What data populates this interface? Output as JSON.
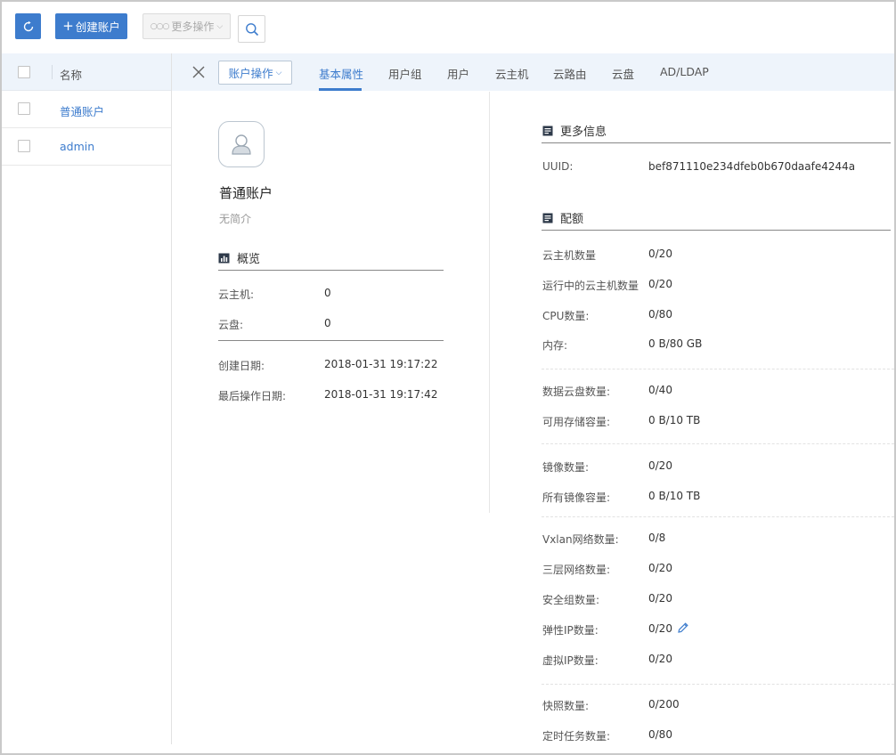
{
  "toolbar": {
    "refresh_icon": "refresh-icon",
    "create_label": "创建账户",
    "more_label": "更多操作",
    "search_icon": "search-icon"
  },
  "list": {
    "header": "名称",
    "rows": [
      "普通账户",
      "admin"
    ]
  },
  "detail": {
    "account_ops_label": "账户操作",
    "tabs": [
      "基本属性",
      "用户组",
      "用户",
      "云主机",
      "云路由",
      "云盘",
      "AD/LDAP"
    ],
    "active_tab": "基本属性"
  },
  "account": {
    "name": "普通账户",
    "description": "无简介"
  },
  "overview": {
    "title": "概览",
    "items": [
      {
        "label": "云主机:",
        "value": "0"
      },
      {
        "label": "云盘:",
        "value": "0"
      }
    ],
    "dates": [
      {
        "label": "创建日期:",
        "value": "2018-01-31 19:17:22"
      },
      {
        "label": "最后操作日期:",
        "value": "2018-01-31 19:17:42"
      }
    ]
  },
  "more_info": {
    "title": "更多信息",
    "uuid_label": "UUID:",
    "uuid_value": "bef871110e234dfeb0b670daafe4244a"
  },
  "quota": {
    "title": "配额",
    "items": [
      {
        "label": "云主机数量",
        "value": "0/20"
      },
      {
        "label": "运行中的云主机数量",
        "value": "0/20"
      },
      {
        "label": "CPU数量:",
        "value": "0/80"
      },
      {
        "label": "内存:",
        "value": "0 B/80 GB"
      },
      {
        "label": "数据云盘数量:",
        "value": "0/40"
      },
      {
        "label": "可用存储容量:",
        "value": "0 B/10 TB"
      },
      {
        "label": "镜像数量:",
        "value": "0/20"
      },
      {
        "label": "所有镜像容量:",
        "value": "0 B/10 TB"
      },
      {
        "label": "Vxlan网络数量:",
        "value": "0/8"
      },
      {
        "label": "三层网络数量:",
        "value": "0/20"
      },
      {
        "label": "安全组数量:",
        "value": "0/20"
      },
      {
        "label": "弹性IP数量:",
        "value": "0/20"
      },
      {
        "label": "虚拟IP数量:",
        "value": "0/20"
      },
      {
        "label": "快照数量:",
        "value": "0/200"
      },
      {
        "label": "定时任务数量:",
        "value": "0/80"
      }
    ]
  }
}
